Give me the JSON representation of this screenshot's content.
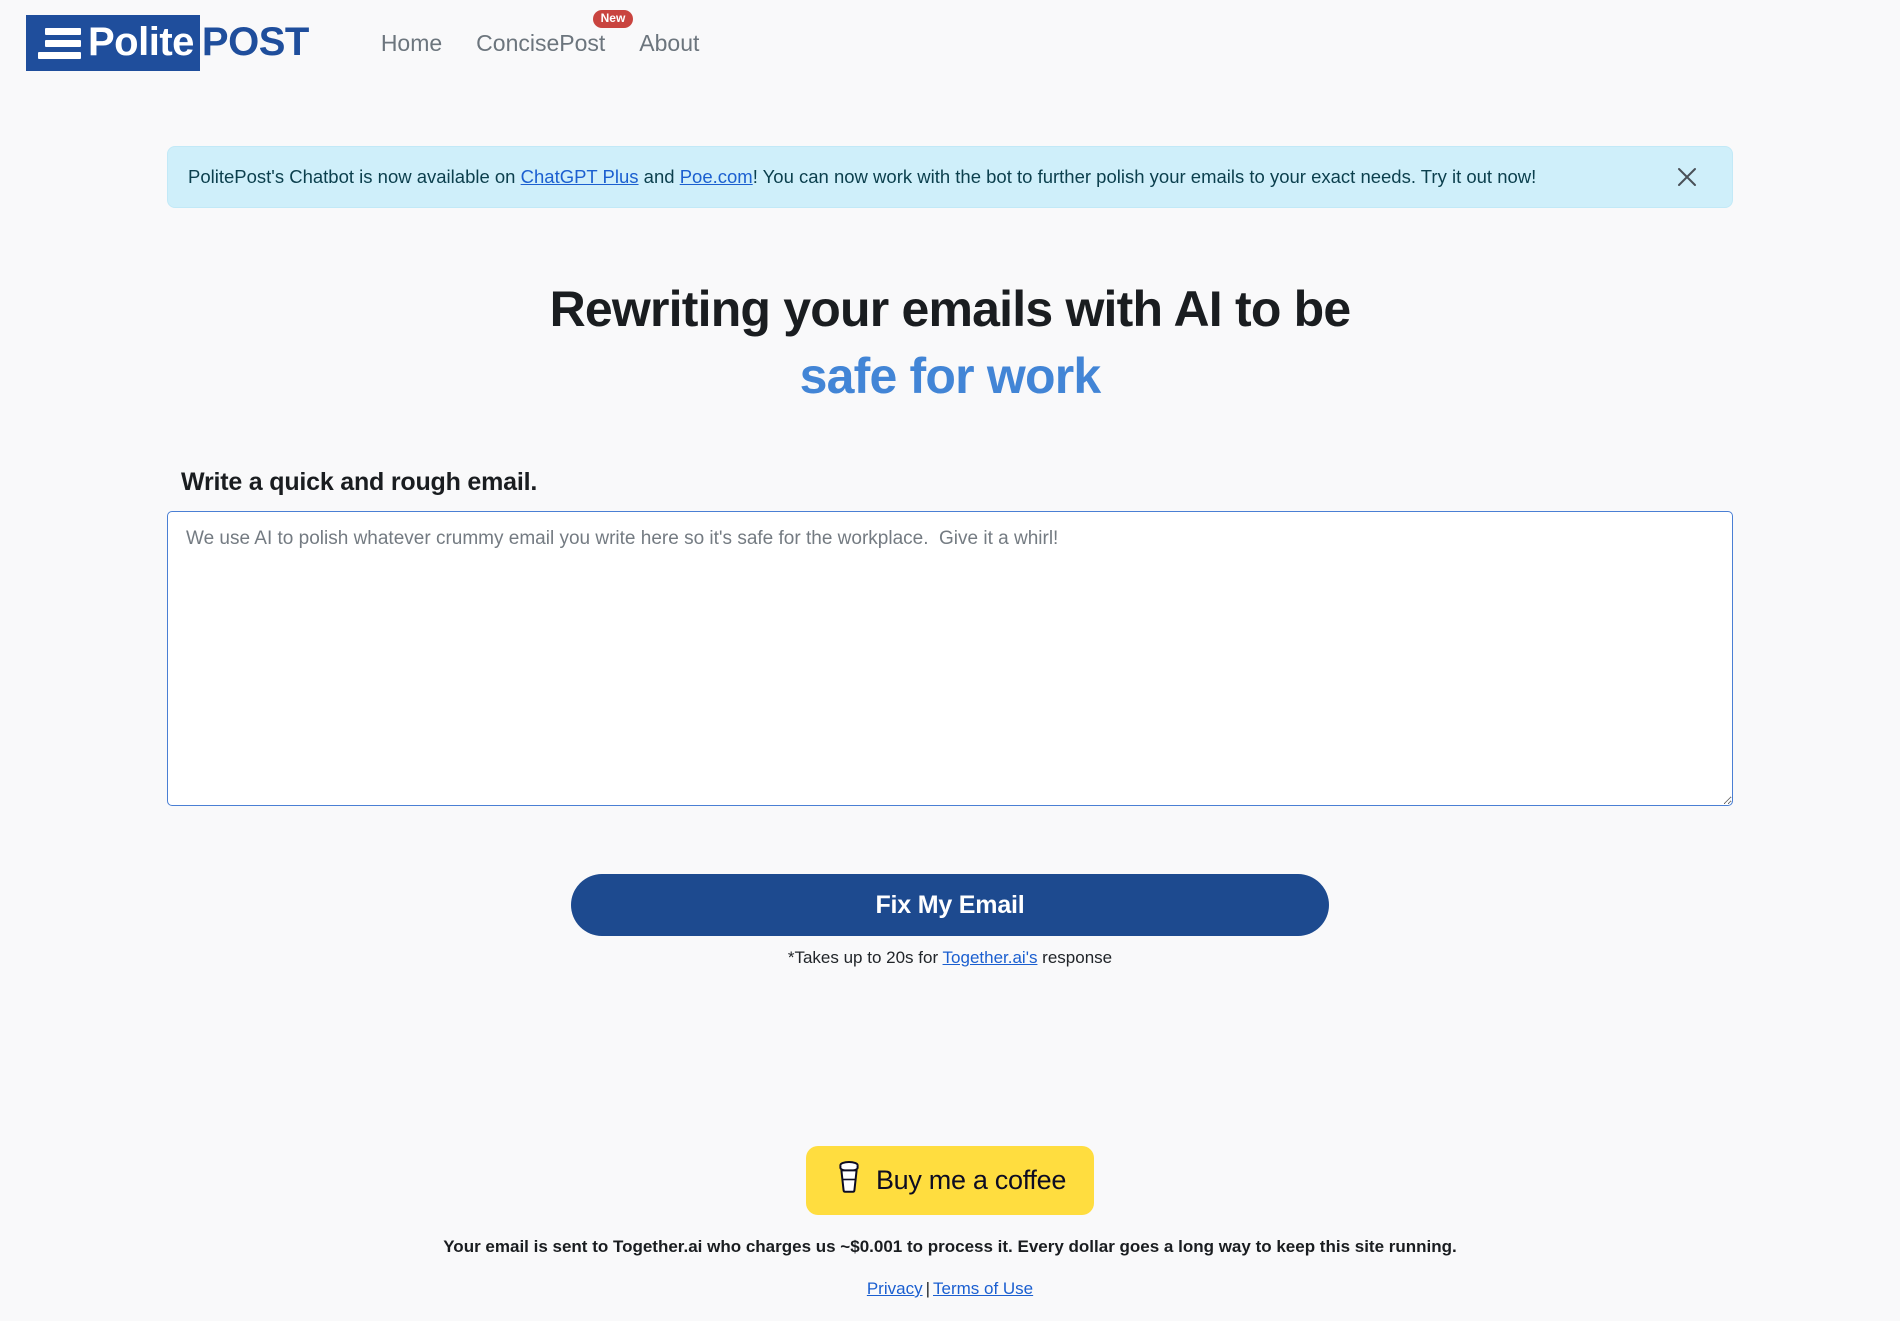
{
  "page": {
    "background_color": "#f9f9fa",
    "brand_blue": "#1f4e9c",
    "accent_blue": "#4285d6",
    "link_blue": "#1b5fd0",
    "alert_bg": "#cfeffa",
    "coffee_yellow": "#ffdd3f",
    "badge_red": "#c9443f"
  },
  "header": {
    "logo": {
      "icon": "hamburger-lines-icon",
      "text_boxed": "Polite",
      "text_plain": "POST"
    },
    "nav": [
      {
        "label": "Home",
        "badge": ""
      },
      {
        "label": "ConcisePost",
        "badge": "New"
      },
      {
        "label": "About",
        "badge": ""
      }
    ]
  },
  "alert": {
    "text_1": "PolitePost's Chatbot is now available on ",
    "link_1": "ChatGPT Plus",
    "text_2": " and ",
    "link_2": "Poe.com",
    "text_3": "! You can now work with the bot to further polish your emails to your exact needs. Try it out now!",
    "close_icon": "close-icon"
  },
  "hero": {
    "line_1": "Rewriting your emails with AI to be",
    "line_2": "safe for work"
  },
  "form": {
    "label": "Write a quick and rough email.",
    "textarea_value": "",
    "textarea_placeholder": "We use AI to polish whatever crummy email you write here so it's safe for the workplace.  Give it a whirl!",
    "submit_label": "Fix My Email",
    "note_prefix": "*Takes up to 20s for ",
    "note_link": "Together.ai's",
    "note_suffix": " response"
  },
  "footer": {
    "coffee_icon": "coffee-cup-icon",
    "coffee_label": "Buy me a coffee",
    "note": "Your email is sent to Together.ai who charges us ~$0.001 to process it. Every dollar goes a long way to keep this site running.",
    "link_privacy": "Privacy",
    "link_separator": "|",
    "link_terms": "Terms of Use"
  }
}
